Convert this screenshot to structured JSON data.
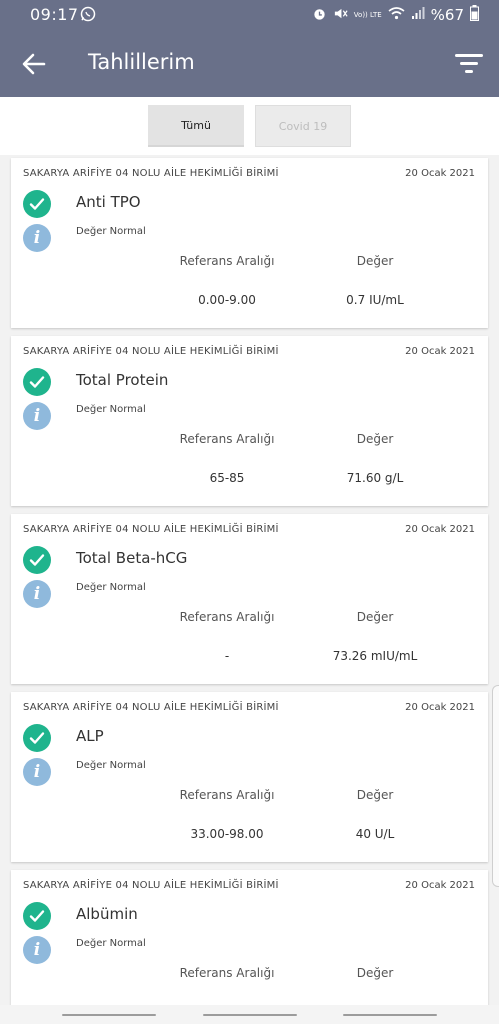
{
  "status_bar": {
    "time": "09:17",
    "battery": "%67",
    "volte": "Vo)) LTE"
  },
  "app_bar": {
    "title": "Tahlillerim",
    "color": "#697089"
  },
  "tabs": [
    {
      "label": "Tümü",
      "selected": true
    },
    {
      "label": "Covid 19",
      "selected": false
    }
  ],
  "labels": {
    "reference_header": "Referans Aralığı",
    "value_header": "Değer"
  },
  "results": [
    {
      "org": "SAKARYA ARİFİYE 04 NOLU AİLE HEKİMLİĞİ BİRİMİ",
      "date": "20 Ocak 2021",
      "test": "Anti TPO",
      "status": "Değer Normal",
      "reference": "0.00-9.00",
      "value": "0.7 IU/mL"
    },
    {
      "org": "SAKARYA ARİFİYE 04 NOLU AİLE HEKİMLİĞİ BİRİMİ",
      "date": "20 Ocak 2021",
      "test": "Total Protein",
      "status": "Değer Normal",
      "reference": "65-85",
      "value": "71.60 g/L"
    },
    {
      "org": "SAKARYA ARİFİYE 04 NOLU AİLE HEKİMLİĞİ BİRİMİ",
      "date": "20 Ocak 2021",
      "test": "Total Beta-hCG",
      "status": "Değer Normal",
      "reference": "-",
      "value": "73.26 mIU/mL"
    },
    {
      "org": "SAKARYA ARİFİYE 04 NOLU AİLE HEKİMLİĞİ BİRİMİ",
      "date": "20 Ocak 2021",
      "test": "ALP",
      "status": "Değer Normal",
      "reference": "33.00-98.00",
      "value": "40 U/L"
    },
    {
      "org": "SAKARYA ARİFİYE 04 NOLU AİLE HEKİMLİĞİ BİRİMİ",
      "date": "20 Ocak 2021",
      "test": "Albümin",
      "status": "Değer Normal",
      "reference": "",
      "value": ""
    }
  ],
  "colors": {
    "check": "#1fb48d",
    "info": "#8fb9dc"
  }
}
